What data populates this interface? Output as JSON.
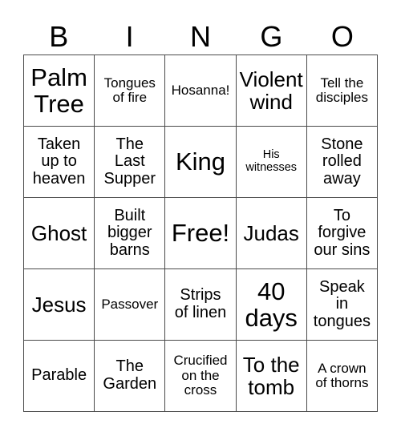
{
  "card": {
    "title_letters": [
      "B",
      "I",
      "N",
      "G",
      "O"
    ],
    "columns": 5,
    "rows": 5,
    "grid_color": "#4a4a4a",
    "background": "#ffffff",
    "text_color": "#000000",
    "cells": [
      {
        "text": "Palm\nTree",
        "size": "s-xl"
      },
      {
        "text": "Tongues\nof fire",
        "size": "s-sm"
      },
      {
        "text": "Hosanna!",
        "size": "s-sm"
      },
      {
        "text": "Violent\nwind",
        "size": "s-lg"
      },
      {
        "text": "Tell the\ndisciples",
        "size": "s-sm"
      },
      {
        "text": "Taken\nup to\nheaven",
        "size": "s-md"
      },
      {
        "text": "The\nLast\nSupper",
        "size": "s-md"
      },
      {
        "text": "King",
        "size": "s-xl"
      },
      {
        "text": "His\nwitnesses",
        "size": "s-xs"
      },
      {
        "text": "Stone\nrolled\naway",
        "size": "s-md"
      },
      {
        "text": "Ghost",
        "size": "s-lg"
      },
      {
        "text": "Built\nbigger\nbarns",
        "size": "s-md"
      },
      {
        "text": "Free!",
        "size": "s-xl"
      },
      {
        "text": "Judas",
        "size": "s-lg"
      },
      {
        "text": "To\nforgive\nour sins",
        "size": "s-md"
      },
      {
        "text": "Jesus",
        "size": "s-lg"
      },
      {
        "text": "Passover",
        "size": "s-sm"
      },
      {
        "text": "Strips\nof linen",
        "size": "s-md"
      },
      {
        "text": "40\ndays",
        "size": "s-xl"
      },
      {
        "text": "Speak\nin\ntongues",
        "size": "s-md"
      },
      {
        "text": "Parable",
        "size": "s-md"
      },
      {
        "text": "The\nGarden",
        "size": "s-md"
      },
      {
        "text": "Crucified\non the\ncross",
        "size": "s-sm"
      },
      {
        "text": "To the\ntomb",
        "size": "s-lg"
      },
      {
        "text": "A crown\nof thorns",
        "size": "s-sm"
      }
    ]
  }
}
